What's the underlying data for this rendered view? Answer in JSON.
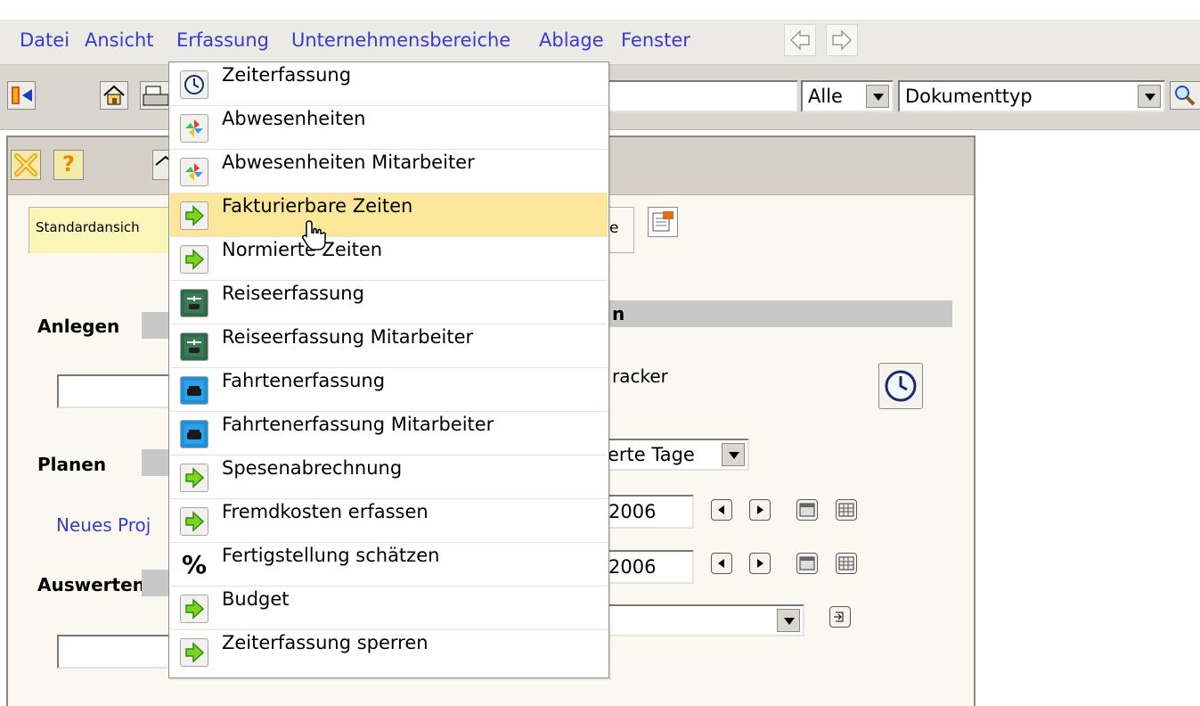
{
  "menubar": {
    "items": [
      "Datei",
      "Ansicht",
      "Erfassung",
      "Unternehmensbereiche",
      "Ablage",
      "Fenster"
    ]
  },
  "toolbar": {
    "filter_value": "Alle",
    "doctype_value": "Dokumenttyp"
  },
  "dropdown": {
    "items": [
      {
        "label": "Zeiterfassung",
        "icon": "clock-icon"
      },
      {
        "label": "Abwesenheiten",
        "icon": "pinwheel-icon"
      },
      {
        "label": "Abwesenheiten Mitarbeiter",
        "icon": "pinwheel-icon"
      },
      {
        "label": "Fakturierbare Zeiten",
        "icon": "green-arrow-icon"
      },
      {
        "label": "Normierte Zeiten",
        "icon": "green-arrow-icon"
      },
      {
        "label": "Reiseerfassung",
        "icon": "travel-icon"
      },
      {
        "label": "Reiseerfassung Mitarbeiter",
        "icon": "travel-icon"
      },
      {
        "label": "Fahrtenerfassung",
        "icon": "car-icon"
      },
      {
        "label": "Fahrtenerfassung Mitarbeiter",
        "icon": "car-icon"
      },
      {
        "label": "Spesenabrechnung",
        "icon": "green-arrow-icon"
      },
      {
        "label": "Fremdkosten erfassen",
        "icon": "green-arrow-icon"
      },
      {
        "label": "Fertigstellung schätzen",
        "icon": "percent-icon"
      },
      {
        "label": "Budget",
        "icon": "green-arrow-icon"
      },
      {
        "label": "Zeiterfassung sperren",
        "icon": "green-arrow-icon"
      }
    ],
    "highlighted_index": 3
  },
  "panel": {
    "tab_standard": "Standardansich",
    "tab_other_fragment": "e",
    "section_anlegen": "Anlegen",
    "section_planen": "Planen",
    "section_auswerten": "Auswerten",
    "link_new_project": "Neues Proj",
    "right_section_fragment": "n",
    "tracker_fragment": "racker",
    "period_select": "erte Tage",
    "date1": "2006",
    "date2": "2006"
  },
  "colors": {
    "menu_link": "#3a3ad0",
    "highlight": "#fbe69a",
    "menubar_bg": "#ebeae6",
    "toolbar_bg": "#d8d6cf",
    "panel_bg": "#faf8f1"
  }
}
